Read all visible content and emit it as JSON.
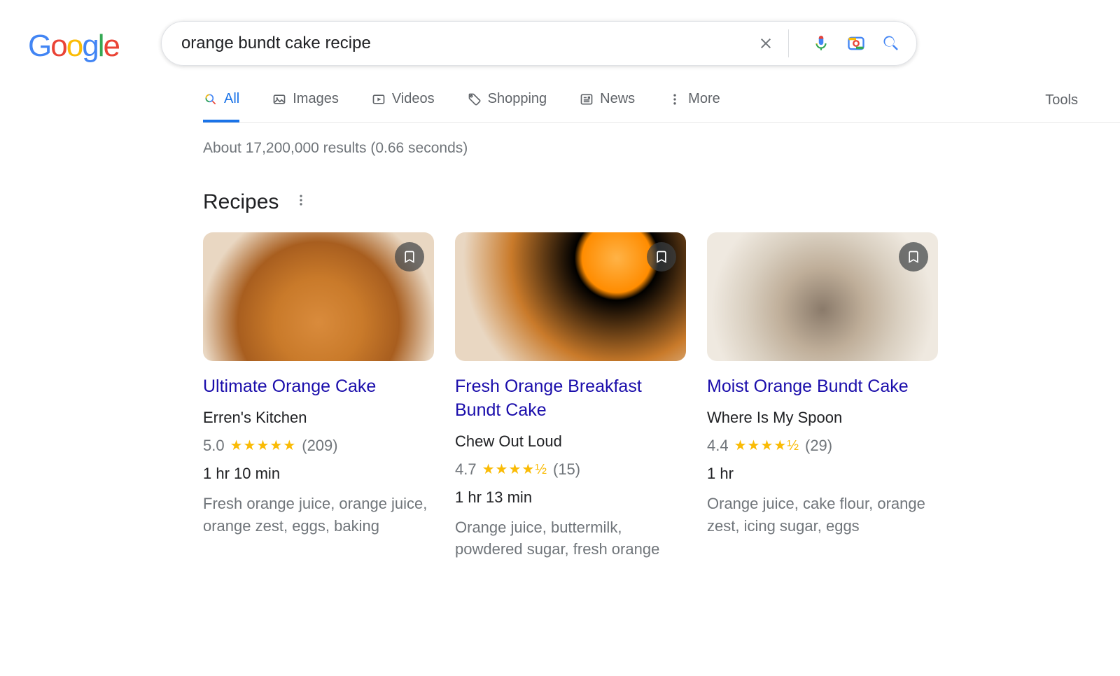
{
  "search": {
    "query": "orange bundt cake recipe"
  },
  "tabs": {
    "all": "All",
    "images": "Images",
    "videos": "Videos",
    "shopping": "Shopping",
    "news": "News",
    "more": "More",
    "tools": "Tools"
  },
  "result_stats": "About 17,200,000 results (0.66 seconds)",
  "section_heading": "Recipes",
  "recipes": [
    {
      "title": "Ultimate Orange Cake",
      "source": "Erren's Kitchen",
      "rating_value": "5.0",
      "rating_count": "(209)",
      "stars_display": "★★★★★",
      "time": "1 hr 10 min",
      "ingredients": "Fresh orange juice, orange juice, orange zest, eggs, baking"
    },
    {
      "title": "Fresh Orange Breakfast Bundt Cake",
      "source": "Chew Out Loud",
      "rating_value": "4.7",
      "rating_count": "(15)",
      "stars_display": "★★★★½",
      "time": "1 hr 13 min",
      "ingredients": "Orange juice, buttermilk, powdered sugar, fresh orange"
    },
    {
      "title": "Moist Orange Bundt Cake",
      "source": "Where Is My Spoon",
      "rating_value": "4.4",
      "rating_count": "(29)",
      "stars_display": "★★★★½",
      "time": "1 hr",
      "ingredients": "Orange juice, cake flour, orange zest, icing sugar, eggs"
    }
  ]
}
